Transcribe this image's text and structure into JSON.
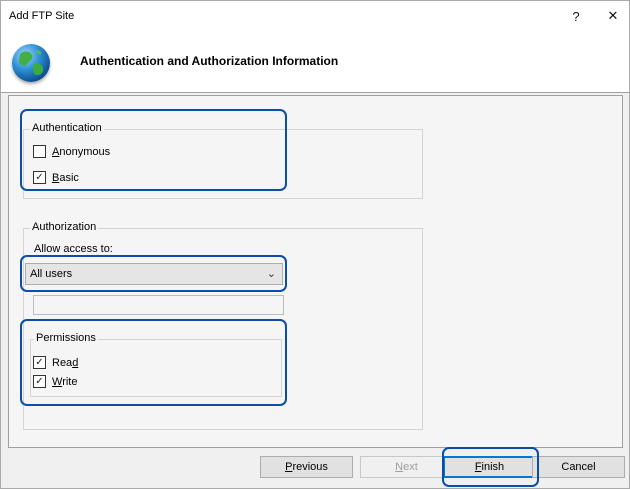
{
  "window": {
    "title": "Add FTP Site",
    "help_glyph": "?",
    "close_glyph": "✕"
  },
  "header": {
    "title": "Authentication and Authorization Information",
    "icon": "globe-icon"
  },
  "authentication": {
    "group_label": "Authentication",
    "anonymous": {
      "prefix": "",
      "key": "A",
      "rest": "nonymous",
      "checked": false
    },
    "basic": {
      "prefix": "",
      "key": "B",
      "rest": "asic",
      "checked": true
    }
  },
  "authorization": {
    "group_label": "Authorization",
    "allow_label": "Allow access to:",
    "selected": "All users",
    "textbox_value": ""
  },
  "permissions": {
    "group_label": "Permissions",
    "read": {
      "prefix": "Rea",
      "key": "d",
      "rest": "",
      "checked": true
    },
    "write": {
      "prefix": "",
      "key": "W",
      "rest": "rite",
      "checked": true
    }
  },
  "buttons": {
    "previous": {
      "prefix": "",
      "key": "P",
      "rest": "revious"
    },
    "next": {
      "prefix": "",
      "key": "N",
      "rest": "ext"
    },
    "finish": {
      "prefix": "",
      "key": "F",
      "rest": "inish"
    },
    "cancel": "Cancel"
  },
  "colors": {
    "highlight": "#0a4ea8",
    "default_button_border": "#0078d7"
  },
  "check_glyph": "✓"
}
